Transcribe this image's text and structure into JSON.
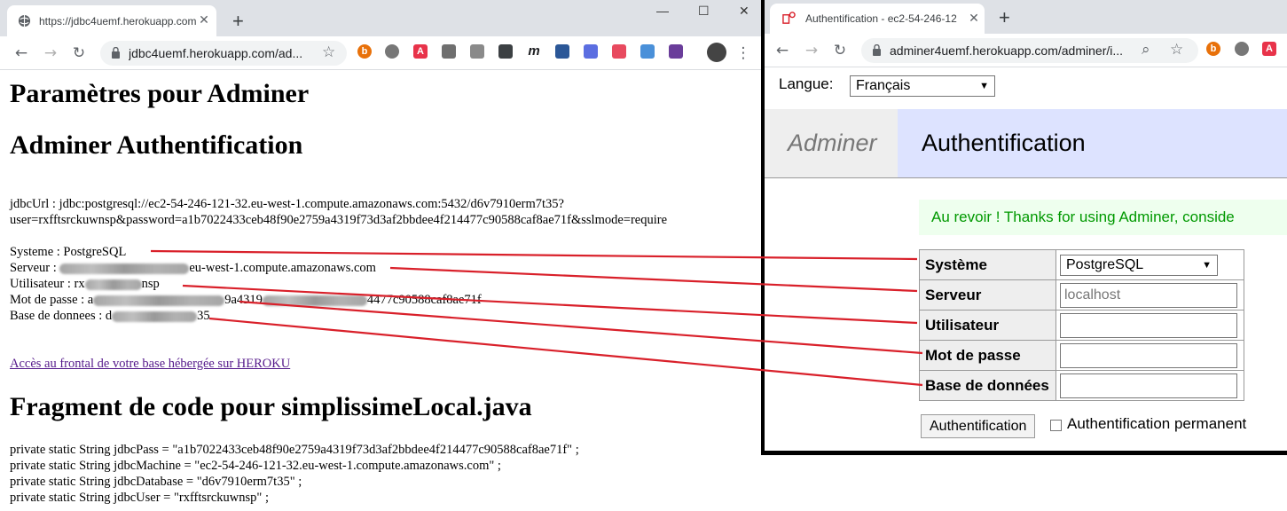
{
  "left_browser": {
    "tab": {
      "title": "https://jdbc4uemf.herokuapp.com"
    },
    "window": {
      "minimize": "—",
      "maximize": "☐",
      "close": "✕"
    },
    "address": {
      "url": "jdbc4uemf.herokuapp.com/ad..."
    },
    "extensions": [
      {
        "icon": "extension-b-icon",
        "label": "b",
        "color": "#e8710a"
      },
      {
        "icon": "extension-grey-circle-icon",
        "label": "",
        "color": "#777777"
      },
      {
        "icon": "extension-a-icon",
        "label": "A",
        "color": "#e8334a"
      },
      {
        "icon": "extension-pocket-icon",
        "label": "",
        "color": "#6f6f6f"
      },
      {
        "icon": "extension-leaf-icon",
        "label": "",
        "color": "#8a8a8a"
      },
      {
        "icon": "extension-check-icon",
        "label": "",
        "color": "#3c4043"
      },
      {
        "icon": "extension-m-icon",
        "label": "m",
        "color": "#202124"
      },
      {
        "icon": "extension-picture-icon",
        "label": "",
        "color": "#2b5797"
      },
      {
        "icon": "extension-blue-check-icon",
        "label": "",
        "color": "#5b6ee1"
      },
      {
        "icon": "extension-rainbow-icon",
        "label": "",
        "color": "#e84a5f"
      },
      {
        "icon": "extension-window-icon",
        "label": "",
        "color": "#4a90d9"
      },
      {
        "icon": "extension-purple-icon",
        "label": "",
        "color": "#6a3d9a"
      }
    ],
    "page": {
      "h1_params": "Paramètres pour Adminer",
      "h1_auth": "Adminer Authentification",
      "jdbc_line1": "jdbcUrl : jdbc:postgresql://ec2-54-246-121-32.eu-west-1.compute.amazonaws.com:5432/d6v7910erm7t35?",
      "jdbc_line2": "user=rxfftsrckuwnsp&password=a1b7022433ceb48f90e2759a4319f73d3af2bbdee4f214477c90588caf8ae71f&sslmode=require",
      "systeme": "Systeme : PostgreSQL",
      "serveur_label": "Serveur : ",
      "serveur_rest": "eu-west-1.compute.amazonaws.com",
      "utilisateur_label": "Utilisateur : ",
      "utilisateur_prefix": "rx",
      "utilisateur_suffix": "nsp",
      "motdepasse_label": "Mot de passe : ",
      "motdepasse_prefix": "a",
      "motdepasse_mid": "9a4319",
      "motdepasse_suffix": "4477c90588caf8ae71f",
      "base_label": "Base de donnees : ",
      "base_prefix": "d",
      "base_suffix": "35",
      "link": "Accès au frontal de votre base hébergée sur HEROKU",
      "h1_fragment": "Fragment de code pour simplissimeLocal.java",
      "code": [
        "private static String jdbcPass = \"a1b7022433ceb48f90e2759a4319f73d3af2bbdee4f214477c90588caf8ae71f\" ;",
        "private static String jdbcMachine = \"ec2-54-246-121-32.eu-west-1.compute.amazonaws.com\" ;",
        "private static String jdbcDatabase = \"d6v7910erm7t35\" ;",
        "private static String jdbcUser = \"rxfftsrckuwnsp\" ;"
      ]
    }
  },
  "right_browser": {
    "tab": {
      "title": "Authentification - ec2-54-246-12"
    },
    "address": {
      "url": "adminer4uemf.herokuapp.com/adminer/i..."
    },
    "page": {
      "langue_label": "Langue:",
      "langue_value": "Français",
      "logo": "Adminer",
      "title": "Authentification",
      "message": "Au revoir ! Thanks for using Adminer, conside",
      "fields": [
        {
          "label": "Système",
          "value": "PostgreSQL",
          "kind": "select"
        },
        {
          "label": "Serveur",
          "value": "",
          "placeholder": "localhost",
          "kind": "input"
        },
        {
          "label": "Utilisateur",
          "value": "",
          "kind": "input"
        },
        {
          "label": "Mot de passe",
          "value": "",
          "kind": "input"
        },
        {
          "label": "Base de données",
          "value": "",
          "kind": "input"
        }
      ],
      "submit": "Authentification",
      "permanent": "Authentification permanent"
    }
  },
  "annotation": {
    "line_color": "#d9202a"
  }
}
